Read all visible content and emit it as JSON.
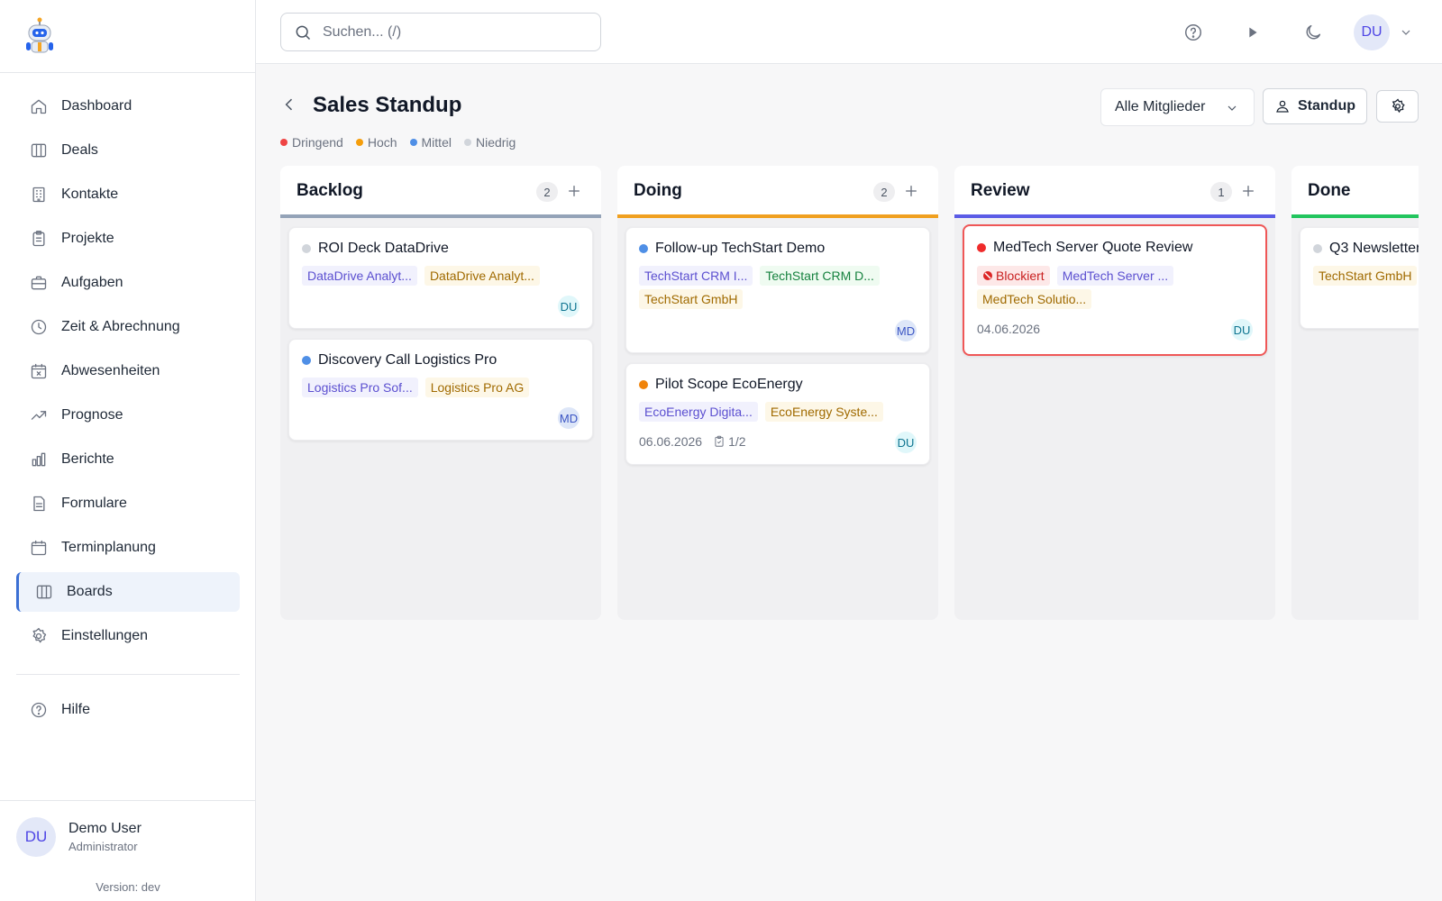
{
  "search": {
    "placeholder": "Suchen... (/)"
  },
  "header": {
    "user_initials": "DU"
  },
  "sidebar": {
    "items": [
      {
        "label": "Dashboard",
        "icon": "home-icon"
      },
      {
        "label": "Deals",
        "icon": "columns-icon"
      },
      {
        "label": "Kontakte",
        "icon": "building-icon"
      },
      {
        "label": "Projekte",
        "icon": "clipboard-icon"
      },
      {
        "label": "Aufgaben",
        "icon": "briefcase-icon"
      },
      {
        "label": "Zeit & Abrechnung",
        "icon": "clock-icon"
      },
      {
        "label": "Abwesenheiten",
        "icon": "calendar-x-icon"
      },
      {
        "label": "Prognose",
        "icon": "trending-up-icon"
      },
      {
        "label": "Berichte",
        "icon": "bar-chart-icon"
      },
      {
        "label": "Formulare",
        "icon": "file-icon"
      },
      {
        "label": "Terminplanung",
        "icon": "calendar-icon"
      },
      {
        "label": "Boards",
        "icon": "columns-icon",
        "active": true
      },
      {
        "label": "Einstellungen",
        "icon": "gear-icon"
      }
    ],
    "help": "Hilfe",
    "user": {
      "initials": "DU",
      "name": "Demo User",
      "role": "Administrator"
    },
    "version": "Version: dev"
  },
  "page": {
    "title": "Sales Standup",
    "legend": [
      {
        "label": "Dringend",
        "color": "#ef4444"
      },
      {
        "label": "Hoch",
        "color": "#f59e0b"
      },
      {
        "label": "Mittel",
        "color": "#4f8fe6"
      },
      {
        "label": "Niedrig",
        "color": "#d1d5db"
      }
    ],
    "member_filter": "Alle Mitglieder",
    "standup_button": "Standup"
  },
  "columns": [
    {
      "title": "Backlog",
      "count": "2",
      "bar_color": "#94a3b8",
      "cards": [
        {
          "title": "ROI Deck DataDrive",
          "priority_color": "#d1d5db",
          "tags": [
            {
              "text": "DataDrive Analyt...",
              "style": "purple"
            },
            {
              "text": "DataDrive Analyt...",
              "style": "yellow"
            }
          ],
          "assignee": "DU"
        },
        {
          "title": "Discovery Call Logistics Pro",
          "priority_color": "#4f8fe6",
          "tags": [
            {
              "text": "Logistics Pro Sof...",
              "style": "purple"
            },
            {
              "text": "Logistics Pro AG",
              "style": "yellow"
            }
          ],
          "assignee": "MD"
        }
      ]
    },
    {
      "title": "Doing",
      "count": "2",
      "bar_color": "#f0a020",
      "cards": [
        {
          "title": "Follow-up TechStart Demo",
          "priority_color": "#4f8fe6",
          "tags": [
            {
              "text": "TechStart CRM I...",
              "style": "purple"
            },
            {
              "text": "TechStart CRM D...",
              "style": "green"
            },
            {
              "text": "TechStart GmbH",
              "style": "yellow"
            }
          ],
          "assignee": "MD"
        },
        {
          "title": "Pilot Scope EcoEnergy",
          "priority_color": "#f0830a",
          "tags": [
            {
              "text": "EcoEnergy Digita...",
              "style": "purple"
            },
            {
              "text": "EcoEnergy Syste...",
              "style": "yellow"
            }
          ],
          "date": "06.06.2026",
          "checklist": "1/2",
          "assignee": "DU"
        }
      ]
    },
    {
      "title": "Review",
      "count": "1",
      "bar_color": "#5b5ce6",
      "cards": [
        {
          "title": "MedTech Server Quote Review",
          "priority_color": "#ef2b2b",
          "blocked": true,
          "tags": [
            {
              "text": "Blockiert",
              "style": "red"
            },
            {
              "text": "MedTech Server ...",
              "style": "purple"
            },
            {
              "text": "MedTech Solutio...",
              "style": "yellow"
            }
          ],
          "date": "04.06.2026",
          "assignee": "DU"
        }
      ]
    },
    {
      "title": "Done",
      "count": "",
      "bar_color": "#22c55e",
      "cards": [
        {
          "title": "Q3 Newsletter",
          "priority_color": "#d1d5db",
          "tags": [
            {
              "text": "TechStart GmbH",
              "style": "yellow"
            }
          ],
          "assignee": ""
        }
      ]
    }
  ]
}
